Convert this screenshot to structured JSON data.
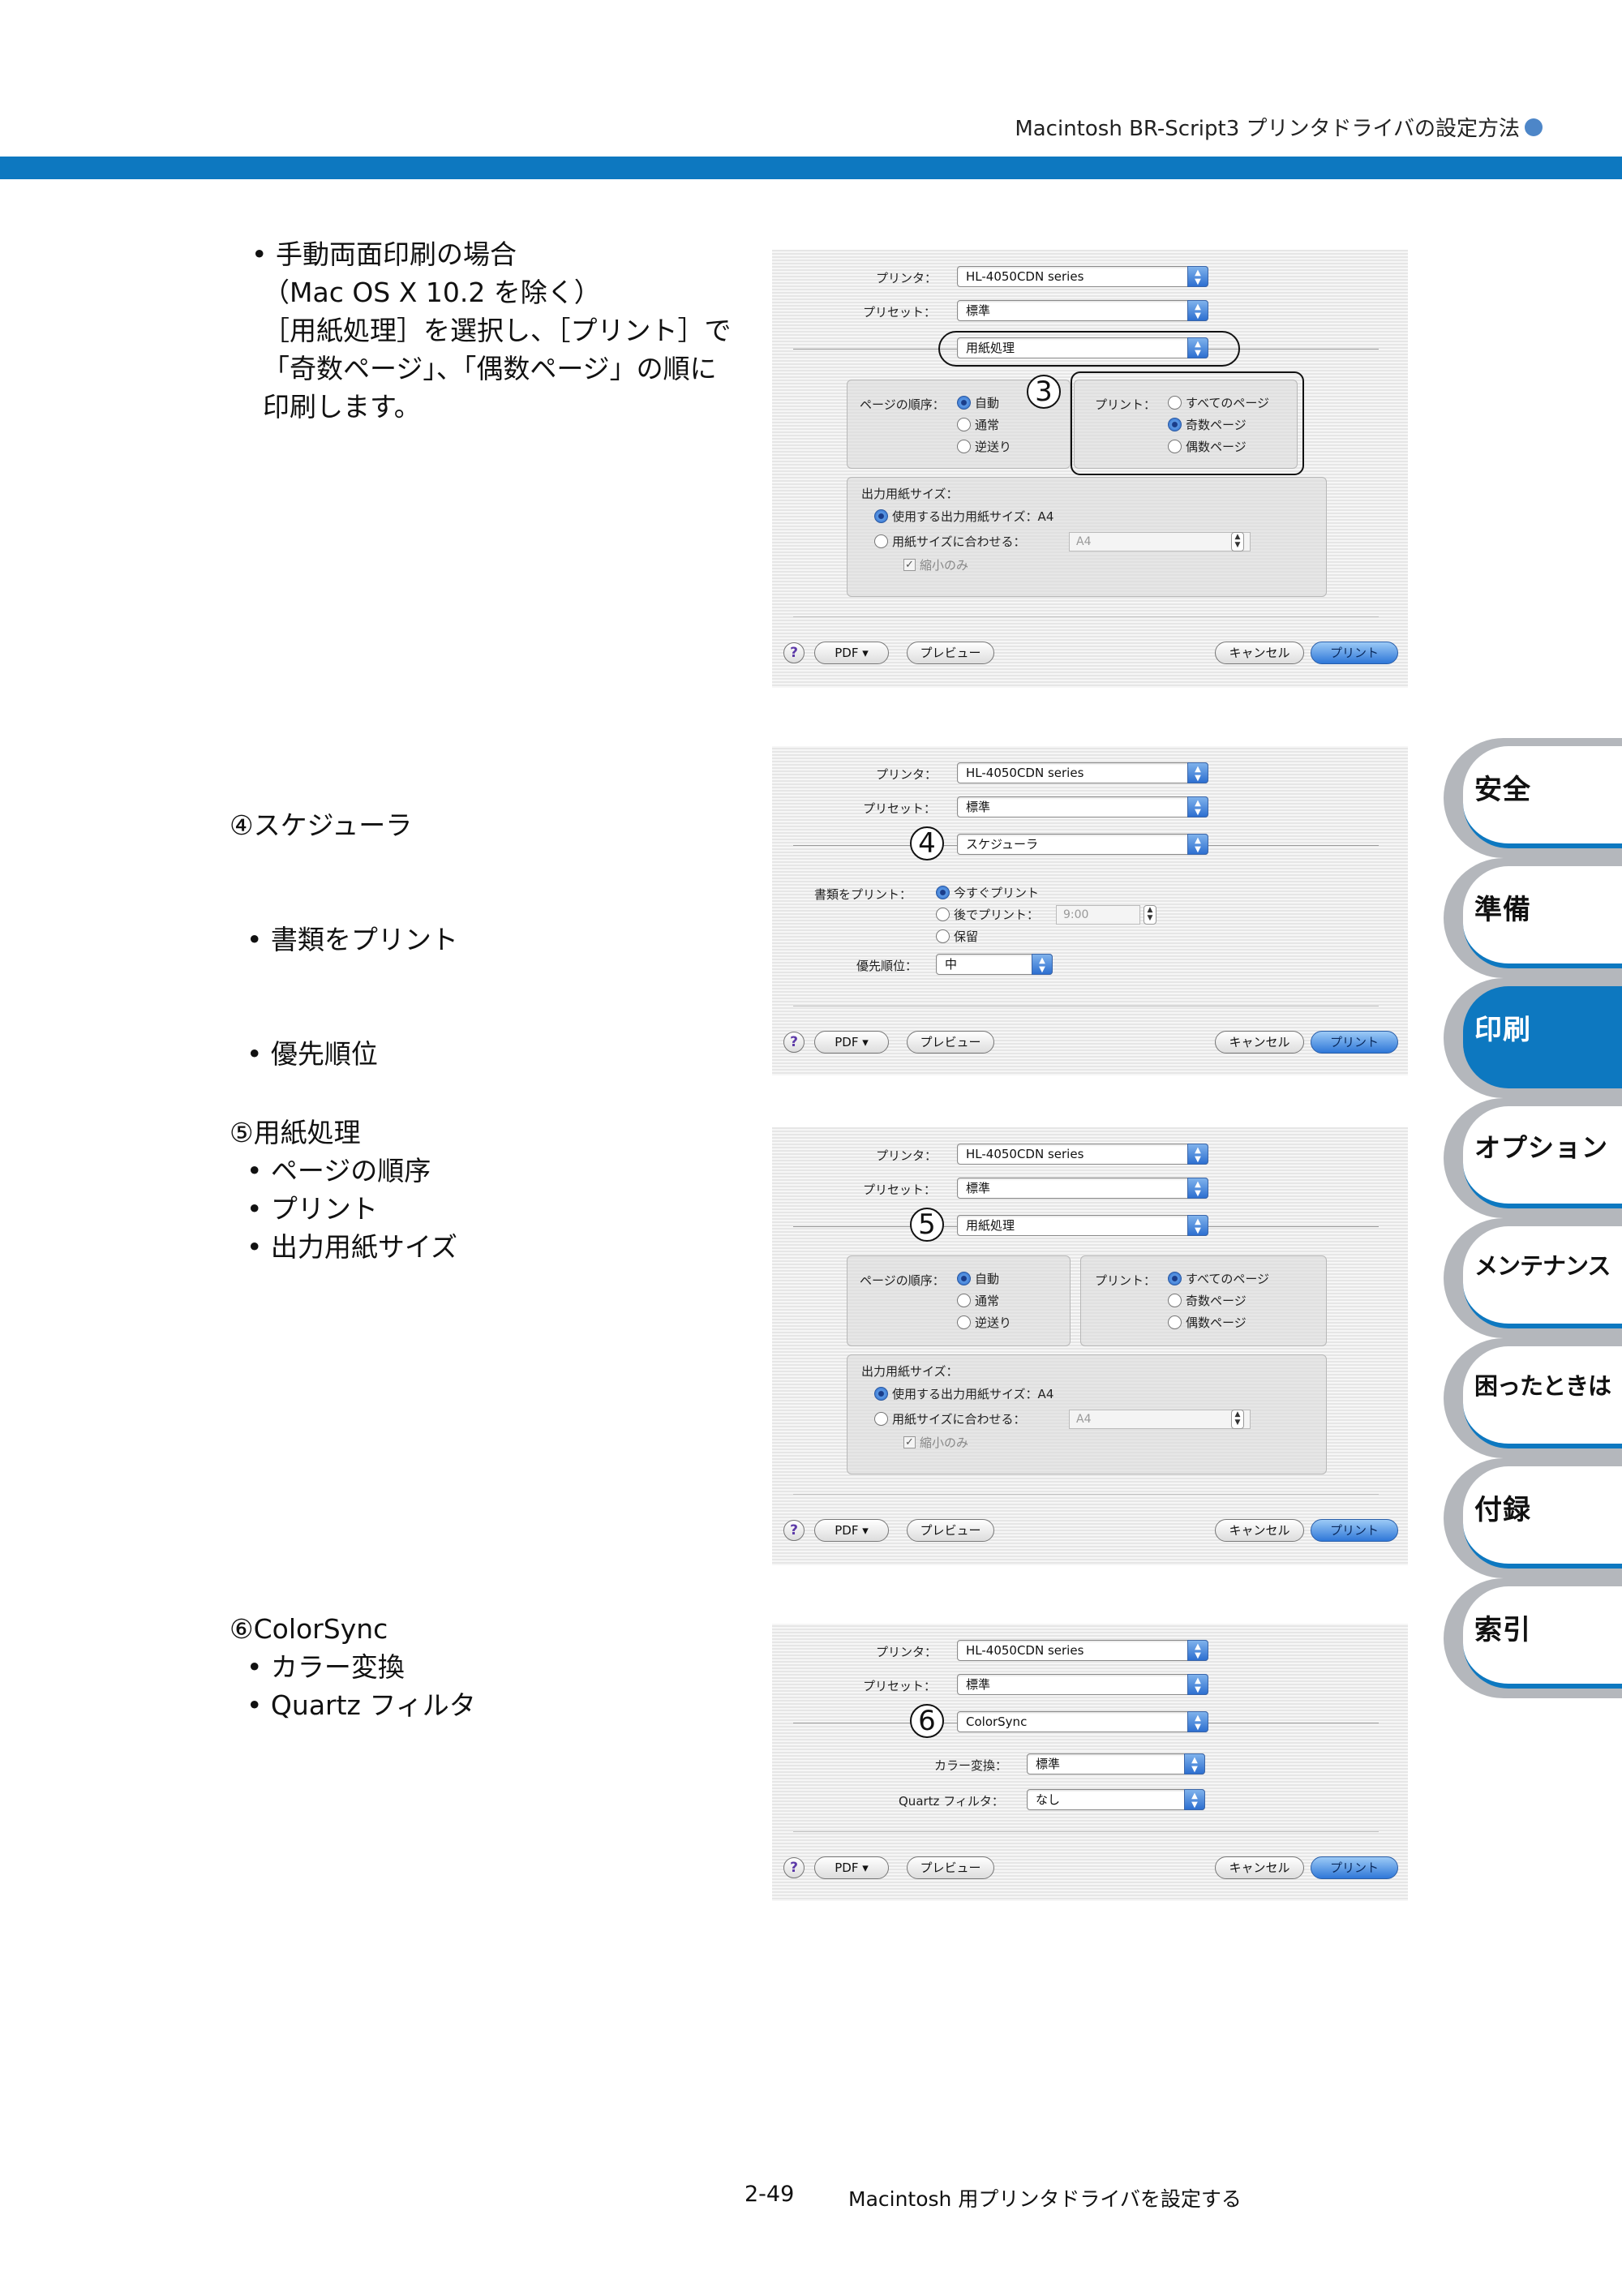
{
  "header": {
    "title": "Macintosh BR-Script3 プリンタドライバの設定方法"
  },
  "sections": [
    {
      "lines": [
        "• 手動両面印刷の場合",
        "（Mac OS  X 10.2 を除く）",
        "［用紙処理］を選択し、［プリント］で",
        "「奇数ページ」、「偶数ページ」の順に",
        "印刷します。"
      ]
    },
    {
      "lines": [
        "④スケジューラ",
        "  • 書類をプリント",
        "  • 優先順位"
      ]
    },
    {
      "lines": [
        "⑤用紙処理",
        "  • ページの順序",
        "  • プリント",
        "  • 出力用紙サイズ"
      ]
    },
    {
      "lines": [
        "⑥ColorSync",
        "  • カラー変換",
        "  • Quartz フィルタ"
      ]
    }
  ],
  "dialog_common": {
    "printer_label": "プリンタ：",
    "printer_value": "HL-4050CDN series",
    "preset_label": "プリセット：",
    "preset_value": "標準",
    "help": "?",
    "pdf": "PDF ▾",
    "preview": "プレビュー",
    "cancel": "キャンセル",
    "print": "プリント"
  },
  "dialog1": {
    "panel": "用紙処理",
    "callout": "3",
    "page_order_label": "ページの順序：",
    "page_order_options": [
      "自動",
      "通常",
      "逆送り"
    ],
    "page_order_selected": 0,
    "print_label": "プリント：",
    "print_options": [
      "すべてのページ",
      "奇数ページ",
      "偶数ページ"
    ],
    "print_selected": 1,
    "output_size_label": "出力用紙サイズ：",
    "output_use": "使用する出力用紙サイズ：A4",
    "output_fit": "用紙サイズに合わせる：",
    "output_fit_value": "A4",
    "shrink_only": "縮小のみ"
  },
  "dialog2": {
    "panel": "スケジューラ",
    "callout": "4",
    "print_doc_label": "書類をプリント：",
    "print_options": [
      "今すぐプリント",
      "後でプリント：",
      "保留"
    ],
    "print_selected": 0,
    "time_value": "9:00",
    "priority_label": "優先順位：",
    "priority_value": "中"
  },
  "dialog3": {
    "panel": "用紙処理",
    "callout": "5",
    "page_order_label": "ページの順序：",
    "page_order_options": [
      "自動",
      "通常",
      "逆送り"
    ],
    "page_order_selected": 0,
    "print_label": "プリント：",
    "print_options": [
      "すべてのページ",
      "奇数ページ",
      "偶数ページ"
    ],
    "print_selected": 0,
    "output_size_label": "出力用紙サイズ：",
    "output_use": "使用する出力用紙サイズ：A4",
    "output_fit": "用紙サイズに合わせる：",
    "output_fit_value": "A4",
    "shrink_only": "縮小のみ"
  },
  "dialog4": {
    "panel": "ColorSync",
    "callout": "6",
    "color_conv_label": "カラー変換：",
    "color_conv_value": "標準",
    "quartz_label": "Quartz フィルタ：",
    "quartz_value": "なし"
  },
  "side_tabs": [
    {
      "label": "安全",
      "active": false
    },
    {
      "label": "準備",
      "active": false
    },
    {
      "label": "印刷",
      "active": true
    },
    {
      "label": "オプション",
      "active": false
    },
    {
      "label": "メンテナンス",
      "active": false
    },
    {
      "label": "困ったときは",
      "active": false
    },
    {
      "label": "付録",
      "active": false
    },
    {
      "label": "索引",
      "active": false
    }
  ],
  "footer": {
    "page": "2-49",
    "title": "Macintosh 用プリンタドライバを設定する"
  },
  "colors": {
    "accent": "#0d78c0",
    "tab_grey": "#b4b7bc"
  }
}
